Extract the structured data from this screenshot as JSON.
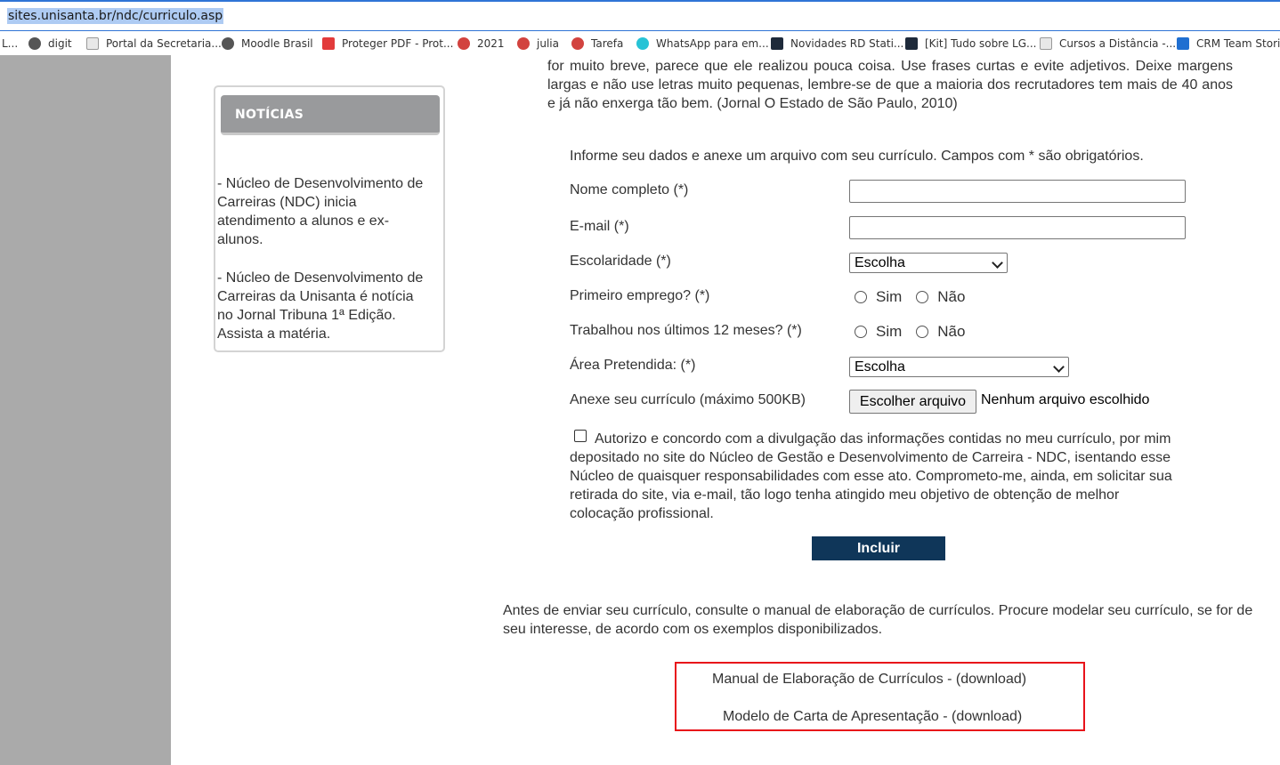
{
  "browser": {
    "url": "sites.unisanta.br/ndc/curriculo.asp",
    "bookmarks": [
      {
        "label": "L...",
        "icon": "none"
      },
      {
        "label": "digit",
        "icon": "globe-icon"
      },
      {
        "label": "Portal da Secretaria...",
        "icon": "document-icon"
      },
      {
        "label": "Moodle Brasil",
        "icon": "globe-icon"
      },
      {
        "label": "Proteger PDF - Prot...",
        "icon": "pdf-icon"
      },
      {
        "label": "2021",
        "icon": "people-icon"
      },
      {
        "label": "julia",
        "icon": "people-icon"
      },
      {
        "label": "Tarefa",
        "icon": "people-icon"
      },
      {
        "label": "WhatsApp para em...",
        "icon": "whatsapp-icon"
      },
      {
        "label": "Novidades RD Stati...",
        "icon": "rd-icon"
      },
      {
        "label": "[Kit] Tudo sobre LG...",
        "icon": "rd-icon"
      },
      {
        "label": "Cursos a Distância -...",
        "icon": "document-icon"
      },
      {
        "label": "CRM Team Stories",
        "icon": "azure-icon"
      }
    ]
  },
  "news": {
    "title": "NOTÍCIAS",
    "items": [
      "- Núcleo de Desenvolvimento de Carreiras (NDC) inicia atendimento a alunos e ex-alunos.",
      "- Núcleo de Desenvolvimento de Carreiras da Unisanta é notícia no Jornal Tribuna 1ª Edição. Assista a matéria."
    ]
  },
  "content": {
    "intro": "for muito breve, parece que ele realizou pouca coisa. Use frases curtas e evite adjetivos. Deixe margens largas e não use letras muito pequenas, lembre-se de que a maioria dos recrutadores tem mais de 40 anos e já não enxerga tão bem. (Jornal O Estado de São Paulo, 2010)",
    "form_intro": "Informe seu dados e anexe um arquivo com seu currículo. Campos com * são obrigatórios.",
    "fields": {
      "name_label": "Nome completo (*)",
      "name_value": "",
      "email_label": "E-mail (*)",
      "email_value": "",
      "education_label": "Escolaridade (*)",
      "education_selected": "Escolha",
      "first_job_label": "Primeiro emprego? (*)",
      "worked_label": "Trabalhou nos últimos 12 meses? (*)",
      "yes_label": "Sim",
      "no_label": "Não",
      "area_label": "Área Pretendida: (*)",
      "area_selected": "Escolha",
      "attach_label": "Anexe seu currículo (máximo 500KB)",
      "file_button": "Escolher arquivo",
      "file_status": "Nenhum arquivo escolhido"
    },
    "consent": "Autorizo e concordo com a divulgação das informações contidas no meu currículo, por mim depositado no site do Núcleo de Gestão e Desenvolvimento de Carreira - NDC, isentando esse Núcleo de quaisquer responsabilidades com esse ato. Comprometo-me, ainda, em solicitar sua retirada do site, via e-mail, tão logo tenha atingido meu objetivo de obtenção de melhor colocação profissional.",
    "submit_label": "Incluir",
    "before_text": "Antes de enviar seu currículo, consulte o manual de elaboração de currículos. Procure modelar seu currículo, se for de seu interesse, de acordo com os exemplos disponibilizados.",
    "downloads": [
      {
        "title": "Manual de Elaboração de Currículos - ",
        "link": "(download)"
      },
      {
        "title": "Modelo de Carta de Apresentação - ",
        "link": "(download)"
      }
    ]
  },
  "colors": {
    "accent": "#2f74d6",
    "sidebar_gray": "#aaaaaa",
    "news_header": "#999a9c",
    "submit_bg": "#0f3659",
    "highlight_box": "#e8131a"
  }
}
